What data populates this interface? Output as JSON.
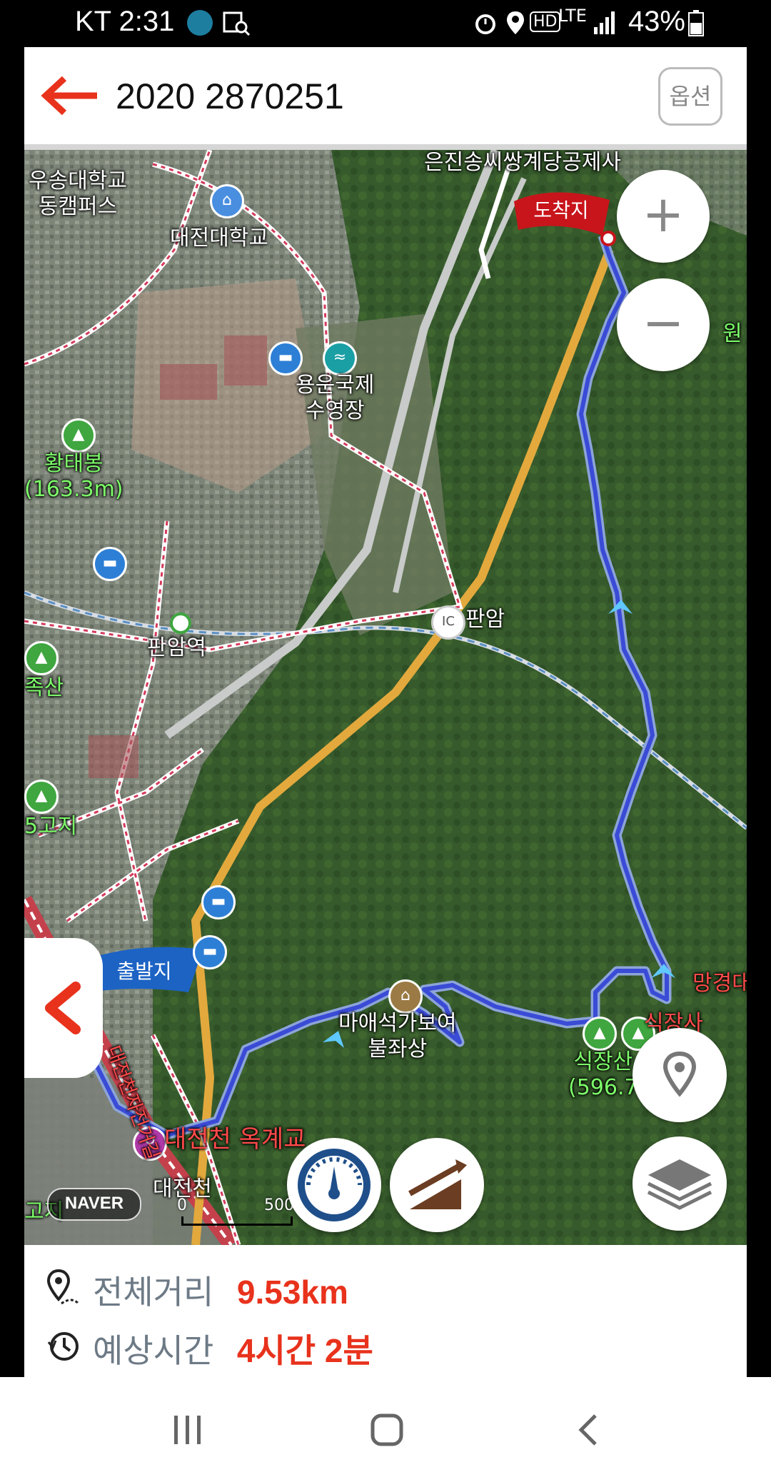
{
  "status_bar": {
    "carrier_time": "KT 2:31",
    "battery": "43%",
    "network": "LTE",
    "hd": "HD"
  },
  "header": {
    "title": "2020 2870251",
    "options_label": "옵션"
  },
  "map": {
    "labels": {
      "u1": "우송대학교\n동캠퍼스",
      "u2": "대전대학교",
      "temple": "은진송씨쌍계당공제사",
      "pool": "용운국제\n수영장",
      "peak1": "황태봉\n(163.3m)",
      "station": "판암역",
      "ic": "판암",
      "ic_badge": "IC",
      "mountain2": "족산",
      "peak3": "5고지",
      "buddha": "마애석가보여\n불좌상",
      "peak4": "식장산\n(596.7",
      "peak4b": "식장사",
      "peak5": "망경대",
      "river_bridge": "대전천 옥계교",
      "river": "대전천",
      "trail": "대전천자전거길",
      "peak6": "고지",
      "start": "출발지",
      "end": "도착지",
      "right_edge": "원"
    },
    "scale_label": "500",
    "scale_zero": "0",
    "naver": "NAVER",
    "zoom_in": "+",
    "zoom_out": "−"
  },
  "summary": {
    "distance_label": "전체거리",
    "distance_value": "9.53km",
    "time_label": "예상시간",
    "time_value": "4시간 2분"
  },
  "colors": {
    "accent": "#e8321c",
    "route": "#3a4bd6",
    "road_orange": "#f5b54a",
    "marker_red": "#c8141b",
    "start_blue": "#1c63c4"
  }
}
